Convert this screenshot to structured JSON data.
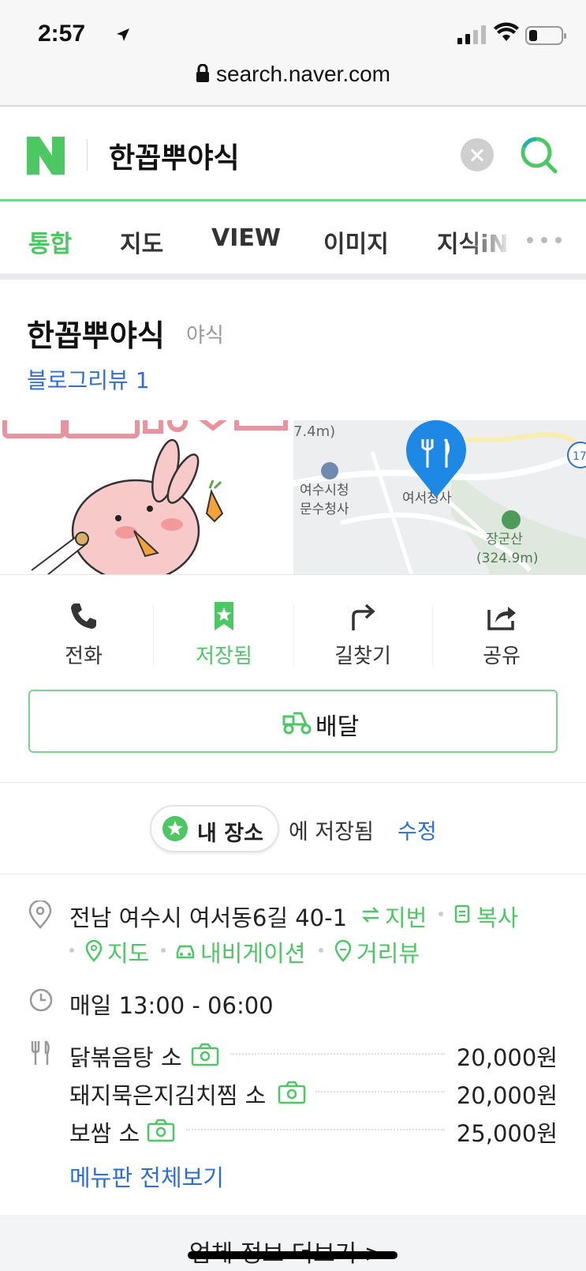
{
  "status_bar": {
    "time": "2:57",
    "url": "search.naver.com"
  },
  "search": {
    "query": "한꼽뿌야식"
  },
  "tabs": [
    {
      "label": "통합",
      "active": true
    },
    {
      "label": "지도",
      "active": false
    },
    {
      "label": "VIEW",
      "active": false
    },
    {
      "label": "이미지",
      "active": false
    },
    {
      "label": "지식iN",
      "active": false
    }
  ],
  "place": {
    "name": "한꼽뿌야식",
    "category": "야식",
    "blog_review": "블로그리뷰 1"
  },
  "map": {
    "labels": [
      "7.4m)",
      "여수시청",
      "문수청사",
      "여서청사",
      "장군산",
      "(324.9m)",
      "17"
    ]
  },
  "actions": [
    {
      "label": "전화",
      "icon": "phone-icon"
    },
    {
      "label": "저장됨",
      "icon": "bookmark-icon"
    },
    {
      "label": "길찾기",
      "icon": "directions-icon"
    },
    {
      "label": "공유",
      "icon": "share-icon"
    }
  ],
  "delivery_label": "배달",
  "saved": {
    "chip": "내 장소",
    "text": "에 저장됨",
    "edit": "수정"
  },
  "address": {
    "text": "전남 여수시 여서동6길 40-1",
    "lot": "지번",
    "copy": "복사",
    "map": "지도",
    "navigation": "내비게이션",
    "street_view": "거리뷰"
  },
  "hours": "매일 13:00 - 06:00",
  "menu": [
    {
      "name": "닭볶음탕 소",
      "price": "20,000원"
    },
    {
      "name": "돼지묵은지김치찜 소",
      "price": "20,000원"
    },
    {
      "name": "보쌈 소",
      "price": "25,000원"
    }
  ],
  "menu_all": "메뉴판 전체보기",
  "more_info": "업체 정보 더보기 >",
  "colors": {
    "brand_green": "#4cc764",
    "link_blue": "#2f6fd1",
    "map_pin": "#1e88e5"
  }
}
